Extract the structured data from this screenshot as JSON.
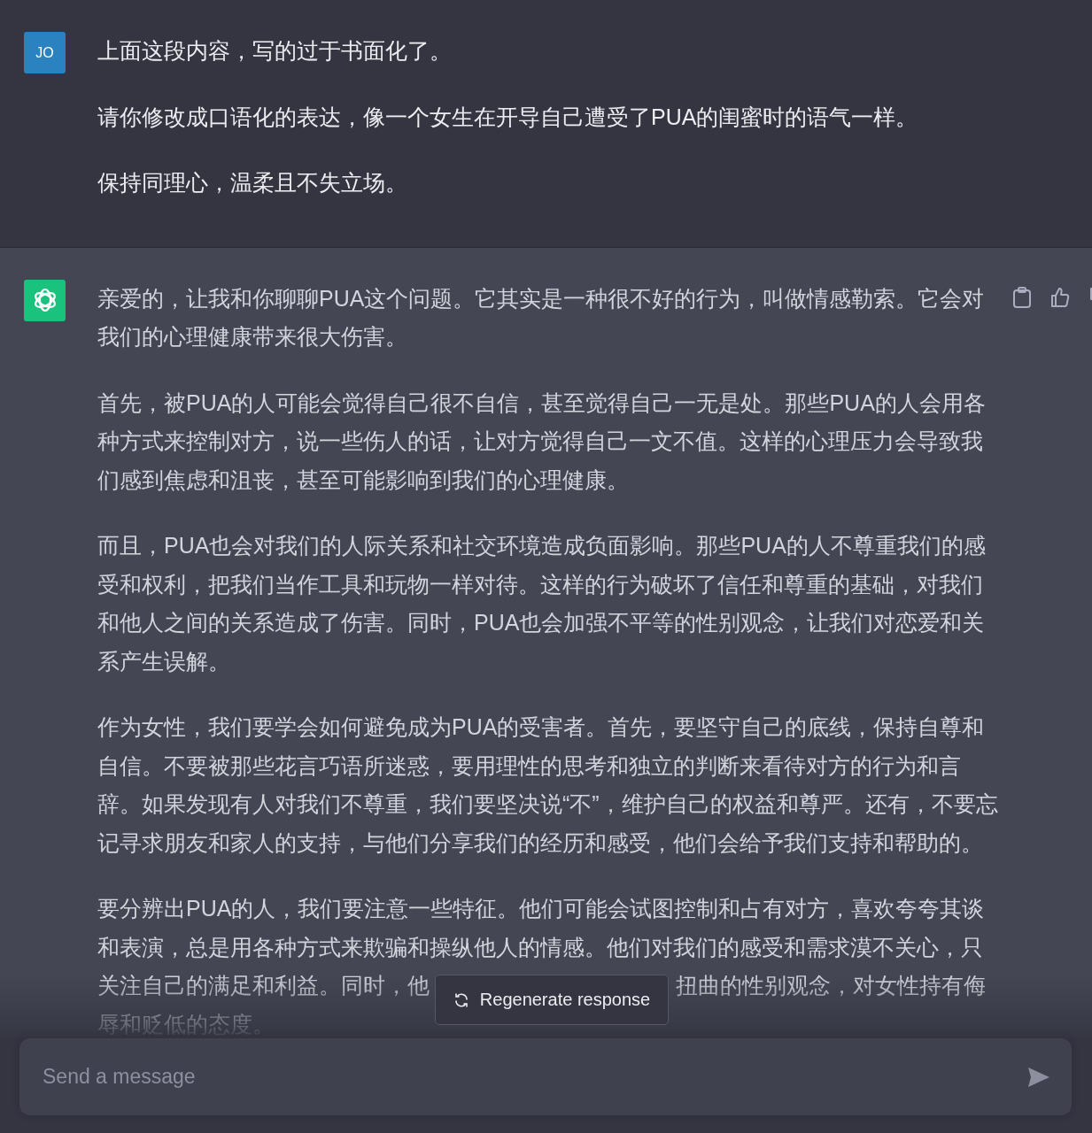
{
  "messages": [
    {
      "kind": "user",
      "avatar": "JO",
      "paragraphs": [
        "上面这段内容，写的过于书面化了。",
        "请你修改成口语化的表达，像一个女生在开导自己遭受了PUA的闺蜜时的语气一样。",
        "保持同理心，温柔且不失立场。"
      ]
    },
    {
      "kind": "assistant",
      "paragraphs": [
        "亲爱的，让我和你聊聊PUA这个问题。它其实是一种很不好的行为，叫做情感勒索。它会对我们的心理健康带来很大伤害。",
        "首先，被PUA的人可能会觉得自己很不自信，甚至觉得自己一无是处。那些PUA的人会用各种方式来控制对方，说一些伤人的话，让对方觉得自己一文不值。这样的心理压力会导致我们感到焦虑和沮丧，甚至可能影响到我们的心理健康。",
        "而且，PUA也会对我们的人际关系和社交环境造成负面影响。那些PUA的人不尊重我们的感受和权利，把我们当作工具和玩物一样对待。这样的行为破坏了信任和尊重的基础，对我们和他人之间的关系造成了伤害。同时，PUA也会加强不平等的性别观念，让我们对恋爱和关系产生误解。",
        "作为女性，我们要学会如何避免成为PUA的受害者。首先，要坚守自己的底线，保持自尊和自信。不要被那些花言巧语所迷惑，要用理性的思考和独立的判断来看待对方的行为和言辞。如果发现有人对我们不尊重，我们要坚决说“不”，维护自己的权益和尊严。还有，不要忘记寻求朋友和家人的支持，与他们分享我们的经历和感受，他们会给予我们支持和帮助的。",
        {
          "lines": [
            [
              "要分辨出PUA的人，我们要注意一些特征。他们可能会试图控制和占有对方，喜欢夸夸其谈和表演，总是用各种方式来欺骗和操纵他人的情感。他们对我们的感受和需求漠不关心，只"
            ],
            [
              "关注自己的满足和利益。同时，他",
              "扭曲的性别观念，对女性持有侮"
            ],
            [
              "辱和贬低的态度。"
            ]
          ]
        }
      ]
    }
  ],
  "regenerate_button": "Regenerate response",
  "composer": {
    "placeholder": "Send a message"
  }
}
